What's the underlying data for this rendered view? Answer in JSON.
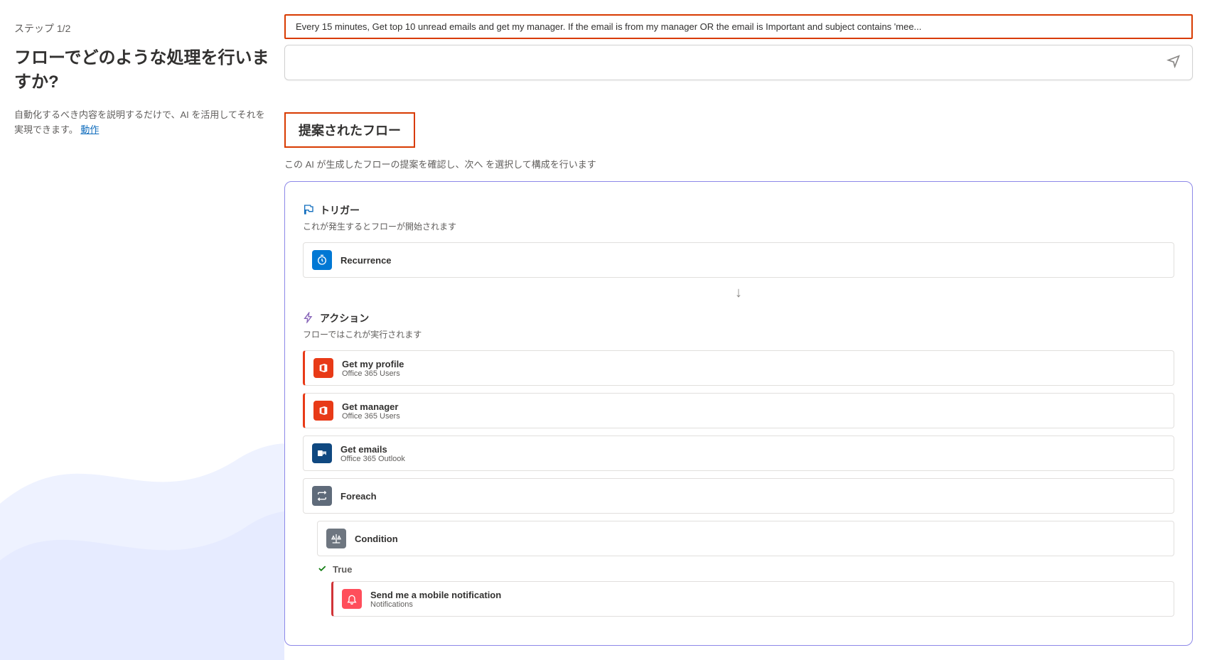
{
  "left": {
    "step_label": "ステップ 1/2",
    "title": "フローでどのような処理を行いますか?",
    "desc_prefix": "自動化するべき内容を説明するだけで、AI を活用してそれを実現できます。",
    "desc_link": "動作"
  },
  "prompt": {
    "text": "Every 15 minutes, Get top 10 unread emails and get my manager. If the email is from my manager OR the email is Important and subject contains 'mee..."
  },
  "suggested": {
    "heading": "提案されたフロー",
    "sub": "この AI が生成したフローの提案を確認し、次へ を選択して構成を行います"
  },
  "trigger_section": {
    "label": "トリガー",
    "sub": "これが発生するとフローが開始されます",
    "card": {
      "title": "Recurrence"
    }
  },
  "action_section": {
    "label": "アクション",
    "sub": "フローではこれが実行されます"
  },
  "actions": {
    "get_profile": {
      "title": "Get my profile",
      "sub": "Office 365 Users"
    },
    "get_manager": {
      "title": "Get manager",
      "sub": "Office 365 Users"
    },
    "get_emails": {
      "title": "Get emails",
      "sub": "Office 365 Outlook"
    },
    "foreach": {
      "title": "Foreach"
    },
    "condition": {
      "title": "Condition"
    },
    "branch_true": "True",
    "notify": {
      "title": "Send me a mobile notification",
      "sub": "Notifications"
    }
  }
}
